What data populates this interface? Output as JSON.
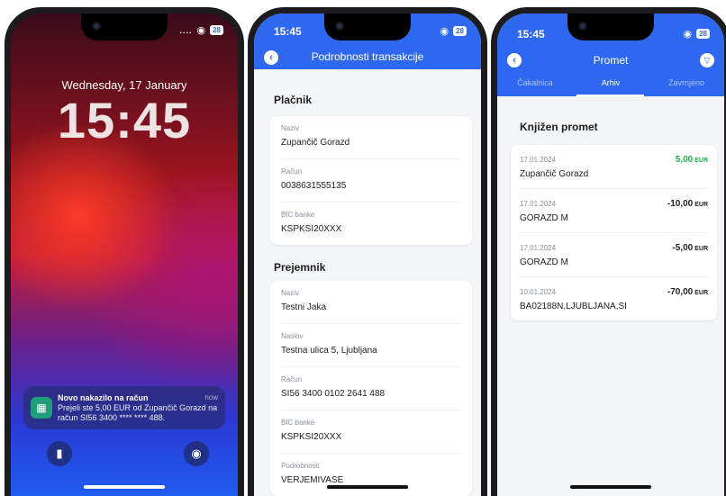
{
  "phone1": {
    "status": {
      "right_dots": "....",
      "battery": "28"
    },
    "lock_date": "Wednesday, 17 January",
    "lock_time": "15:45",
    "notification": {
      "title": "Novo nakazilo na račun",
      "time": "now",
      "body": "Prejeli ste 5,00 EUR od Zupančič Gorazd na račun SI56 3400 **** **** 488."
    }
  },
  "phone2": {
    "status": {
      "time": "15:45",
      "battery": "28"
    },
    "title": "Podrobnosti transakcije",
    "payer": {
      "heading": "Plačnik",
      "fields": [
        {
          "label": "Naziv",
          "value": "Zupančič Gorazd"
        },
        {
          "label": "Račun",
          "value": "0038631555135"
        },
        {
          "label": "BIC banke",
          "value": "KSPKSI20XXX"
        }
      ]
    },
    "recipient": {
      "heading": "Prejemnik",
      "fields": [
        {
          "label": "Naziv",
          "value": "Testni Jaka"
        },
        {
          "label": "Naslov",
          "value": "Testna ulica 5, Ljubljana"
        },
        {
          "label": "Račun",
          "value": "SI56 3400 0102 2641 488"
        },
        {
          "label": "BIC banke",
          "value": "KSPKSI20XXX"
        },
        {
          "label": "Podrobnosti",
          "value": "VERJEMIVASE"
        }
      ]
    }
  },
  "phone3": {
    "status": {
      "time": "15:45",
      "battery": "28"
    },
    "title": "Promet",
    "tabs": [
      "Čakalnica",
      "Arhiv",
      "Zavrnjeno"
    ],
    "active_tab": "Arhiv",
    "section_title": "Knjižen promet",
    "transactions": [
      {
        "date": "17.01.2024",
        "name": "Zupančič Gorazd",
        "amount": "5,00",
        "currency": "EUR",
        "positive": true
      },
      {
        "date": "17.01.2024",
        "name": "GORAZD M",
        "amount": "-10,00",
        "currency": "EUR",
        "positive": false
      },
      {
        "date": "17.01.2024",
        "name": "GORAZD M",
        "amount": "-5,00",
        "currency": "EUR",
        "positive": false
      },
      {
        "date": "10.01.2024",
        "name": "BA02188N,LJUBLJANA,SI",
        "amount": "-70,00",
        "currency": "EUR",
        "positive": false
      }
    ],
    "colors": {
      "accent": "#2f68f0",
      "positive": "#1fb04a"
    }
  }
}
